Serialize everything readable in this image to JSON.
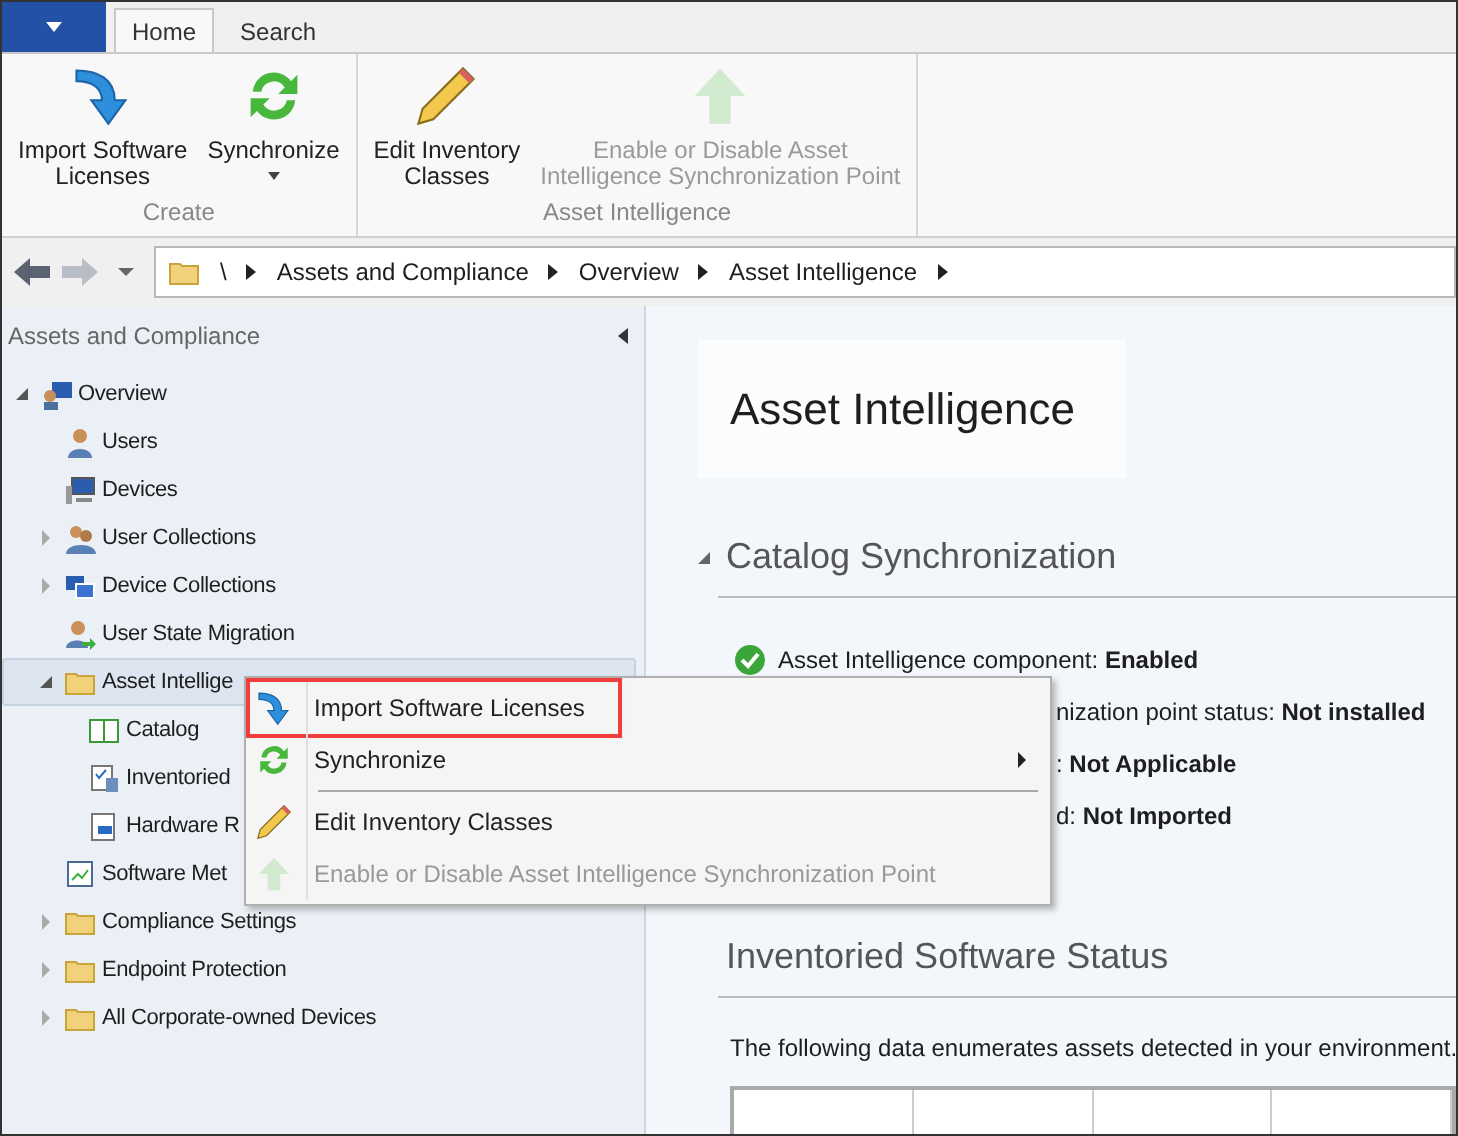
{
  "ribbon": {
    "tabs": [
      {
        "label": "Home",
        "selected": true
      },
      {
        "label": "Search",
        "selected": false
      }
    ],
    "groups": [
      {
        "label": "Create",
        "buttons": [
          {
            "label": "Import Software\nLicenses",
            "disabled": false,
            "dropdown": false
          },
          {
            "label": "Synchronize",
            "disabled": false,
            "dropdown": true
          }
        ]
      },
      {
        "label": "Asset Intelligence",
        "buttons": [
          {
            "label": "Edit Inventory\nClasses",
            "disabled": false,
            "dropdown": false
          },
          {
            "label": "Enable or Disable Asset\nIntelligence Synchronization Point",
            "disabled": true,
            "dropdown": false
          }
        ]
      }
    ]
  },
  "address_bar": {
    "path": [
      "\\",
      "Assets and Compliance",
      "Overview",
      "Asset Intelligence"
    ]
  },
  "navigation_pane": {
    "title": "Assets and Compliance",
    "tree": [
      {
        "label": "Overview",
        "expanded": true,
        "selected": false,
        "children": [
          {
            "label": "Users",
            "selected": false
          },
          {
            "label": "Devices",
            "selected": false
          },
          {
            "label": "User Collections",
            "expanded": false,
            "selected": false
          },
          {
            "label": "Device Collections",
            "expanded": false,
            "selected": false
          },
          {
            "label": "User State Migration",
            "selected": false
          },
          {
            "label": "Asset Intellige",
            "expanded": true,
            "selected": true,
            "children": [
              {
                "label": "Catalog",
                "selected": false
              },
              {
                "label": "Inventoried",
                "selected": false
              },
              {
                "label": "Hardware R",
                "selected": false
              }
            ]
          },
          {
            "label": "Software Met",
            "selected": false
          },
          {
            "label": "Compliance Settings",
            "expanded": false,
            "selected": false
          },
          {
            "label": "Endpoint Protection",
            "expanded": false,
            "selected": false
          },
          {
            "label": "All Corporate-owned Devices",
            "expanded": false,
            "selected": false
          }
        ]
      }
    ]
  },
  "main": {
    "title": "Asset Intelligence",
    "sections": [
      {
        "heading": "Catalog Synchronization",
        "collapsible": true,
        "lines": [
          {
            "text": "Asset Intelligence component: **Enabled**",
            "success": true,
            "covered": false
          },
          {
            "text": "nization point status: **Not installed**",
            "success": false,
            "covered": true
          },
          {
            "text": ": **Not Applicable**",
            "success": false,
            "covered": true
          },
          {
            "text": "d: **Not Imported**",
            "success": false,
            "covered": true
          }
        ]
      },
      {
        "heading": "Inventoried Software Status",
        "collapsible": false,
        "paragraph": "The following data enumerates assets detected in your environment."
      }
    ]
  },
  "context_menu": {
    "items": [
      {
        "kind": "item",
        "label": "Import Software Licenses",
        "highlighted": true,
        "disabled": false,
        "submenu": false
      },
      {
        "kind": "item",
        "label": "Synchronize",
        "highlighted": false,
        "disabled": false,
        "submenu": true
      },
      {
        "kind": "separator"
      },
      {
        "kind": "item",
        "label": "Edit Inventory Classes",
        "highlighted": false,
        "disabled": false,
        "submenu": false
      },
      {
        "kind": "item",
        "label": "Enable or Disable Asset Intelligence Synchronization Point",
        "highlighted": false,
        "disabled": true,
        "submenu": false
      }
    ]
  }
}
